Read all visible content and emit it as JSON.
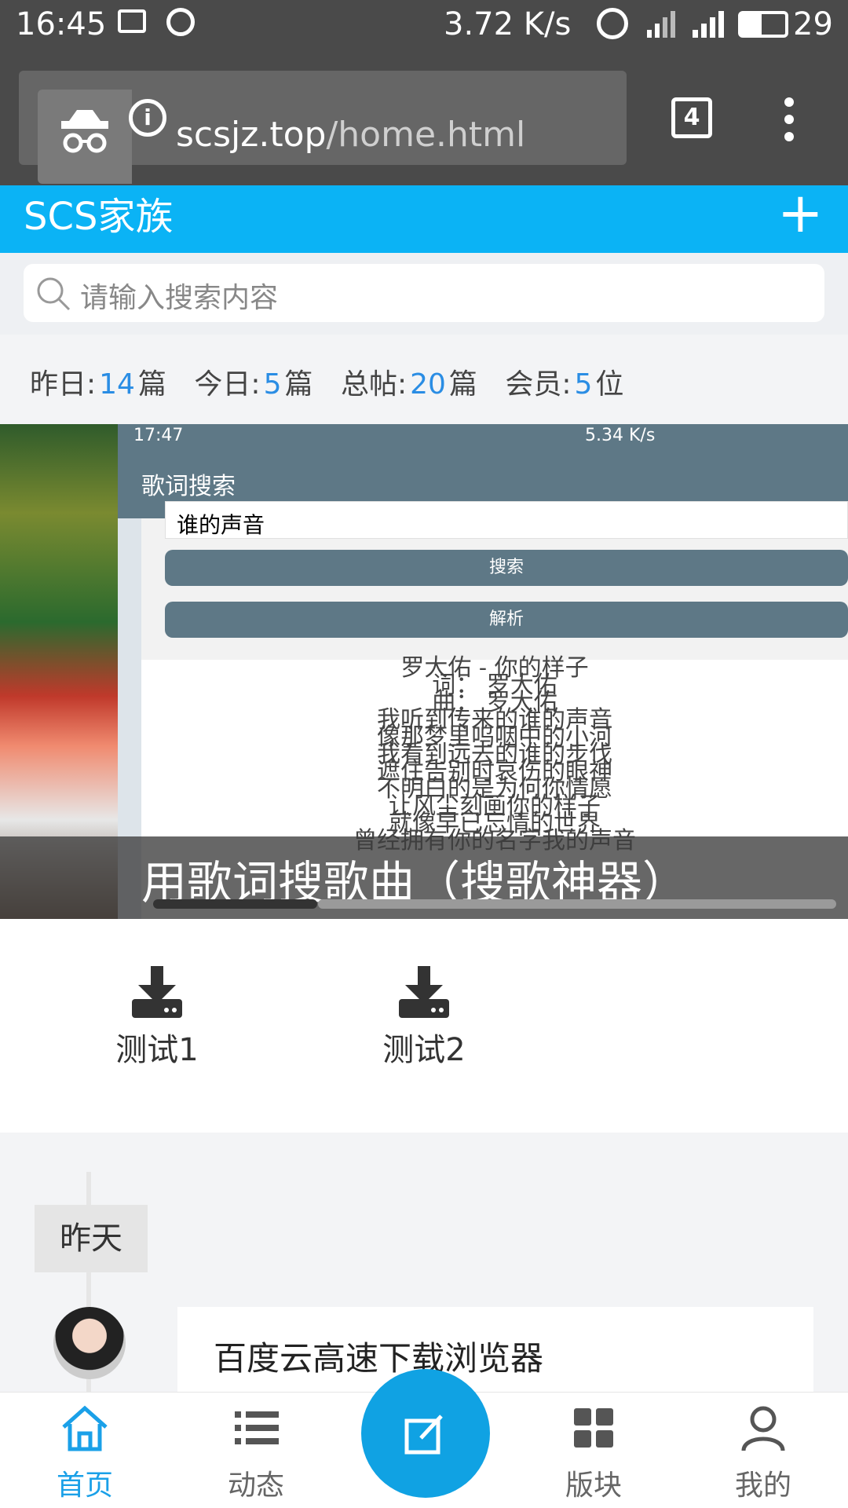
{
  "status_bar": {
    "time": "16:45",
    "speed": "3.72 K/s",
    "battery": "29"
  },
  "browser": {
    "url_host": "scsjz.top",
    "url_path": "/home.html",
    "tab_count": "4"
  },
  "app": {
    "title": "SCS家族",
    "search_placeholder": "请输入搜索内容",
    "stats": {
      "yesterday_label": "昨日:",
      "yesterday_value": "14",
      "yesterday_unit": "篇",
      "today_label": "今日:",
      "today_value": "5",
      "today_unit": "篇",
      "total_label": "总帖:",
      "total_value": "20",
      "total_unit": "篇",
      "members_label": "会员:",
      "members_value": "5",
      "members_unit": "位"
    },
    "banner": {
      "caption": "用歌词搜歌曲（搜歌神器）",
      "screenshot_status_time": "17:47",
      "screenshot_status_speed": "5.34 K/s",
      "screenshot_title": "歌词搜索",
      "screenshot_input": "谁的声音",
      "screenshot_search_btn": "搜索",
      "screenshot_parse_btn": "解析",
      "lyrics": [
        "罗大佑 - 你的样子",
        "词：  罗大佑",
        "曲：  罗大佑",
        "我听到传来的谁的声音",
        "像那梦里呜咽中的小河",
        "我看到远去的谁的步伐",
        "遮住告别时哀伤的眼神",
        "不明白的是为何你情愿",
        "让风尘刻画你的样子",
        "就像早已忘情的世界",
        "曾经拥有你的名字我的声音"
      ],
      "progress": 0.24
    },
    "shortcuts": [
      {
        "label": "测试1",
        "icon": "download-icon"
      },
      {
        "label": "测试2",
        "icon": "download-icon"
      }
    ],
    "timeline": {
      "day": "昨天",
      "post_title": "百度云高速下载浏览器"
    },
    "nav": [
      {
        "label": "首页",
        "icon": "home-icon",
        "active": true
      },
      {
        "label": "动态",
        "icon": "list-icon",
        "active": false
      },
      {
        "label": "",
        "icon": "compose-icon",
        "active": false
      },
      {
        "label": "版块",
        "icon": "grid-icon",
        "active": false
      },
      {
        "label": "我的",
        "icon": "user-icon",
        "active": false
      }
    ],
    "colors": {
      "brand_blue": "#0bb3f5",
      "accent_blue": "#1aa0e8",
      "stat_number": "#2a8de4"
    }
  }
}
